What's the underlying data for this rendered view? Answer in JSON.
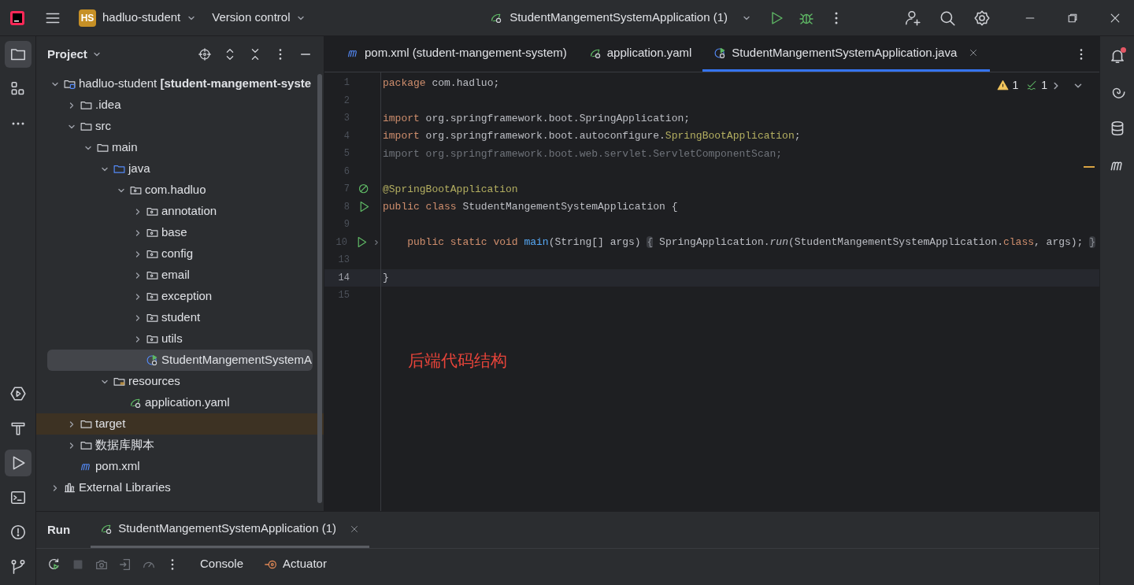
{
  "title_bar": {
    "project_badge": "HS",
    "project": "hadluo-student",
    "vcs": "Version control",
    "run_config": "StudentMangementSystemApplication (1)"
  },
  "left_toolbar": {
    "top": [
      {
        "kind": "folder",
        "selected": true
      },
      {
        "kind": "structure",
        "selected": false
      },
      {
        "kind": "more",
        "selected": false
      }
    ],
    "bottom": [
      {
        "kind": "services",
        "selected": false
      },
      {
        "kind": "build",
        "selected": false
      },
      {
        "kind": "run",
        "selected": true
      },
      {
        "kind": "terminal",
        "selected": false
      },
      {
        "kind": "problems",
        "selected": false
      },
      {
        "kind": "git",
        "selected": false
      }
    ]
  },
  "project_panel": {
    "title": "Project",
    "tree": [
      {
        "label": "hadluo-student **[student-mangement-syste**",
        "kind": "module",
        "expanded": true,
        "selected": false,
        "excluded": false,
        "children": [
          {
            "label": ".idea",
            "kind": "folder",
            "expanded": false,
            "selected": false,
            "excluded": false
          },
          {
            "label": "src",
            "kind": "folder",
            "expanded": true,
            "selected": false,
            "excluded": false,
            "children": [
              {
                "label": "main",
                "kind": "folder",
                "expanded": true,
                "selected": false,
                "excluded": false,
                "children": [
                  {
                    "label": "java",
                    "kind": "source",
                    "expanded": true,
                    "selected": false,
                    "excluded": false,
                    "children": [
                      {
                        "label": "com.hadluo",
                        "kind": "package",
                        "expanded": true,
                        "selected": false,
                        "excluded": false,
                        "children": [
                          {
                            "label": "annotation",
                            "kind": "package",
                            "expanded": false,
                            "selected": false,
                            "excluded": false
                          },
                          {
                            "label": "base",
                            "kind": "package",
                            "expanded": false,
                            "selected": false,
                            "excluded": false
                          },
                          {
                            "label": "config",
                            "kind": "package",
                            "expanded": false,
                            "selected": false,
                            "excluded": false
                          },
                          {
                            "label": "email",
                            "kind": "package",
                            "expanded": false,
                            "selected": false,
                            "excluded": false
                          },
                          {
                            "label": "exception",
                            "kind": "package",
                            "expanded": false,
                            "selected": false,
                            "excluded": false
                          },
                          {
                            "label": "student",
                            "kind": "package",
                            "expanded": false,
                            "selected": false,
                            "excluded": false
                          },
                          {
                            "label": "utils",
                            "kind": "package",
                            "expanded": false,
                            "selected": false,
                            "excluded": false
                          },
                          {
                            "label": "StudentMangementSystemA",
                            "kind": "spring-class",
                            "selected": true,
                            "excluded": false
                          }
                        ]
                      }
                    ]
                  },
                  {
                    "label": "resources",
                    "kind": "resources",
                    "expanded": true,
                    "selected": false,
                    "excluded": false,
                    "children": [
                      {
                        "label": "application.yaml",
                        "kind": "yaml",
                        "selected": false,
                        "excluded": false
                      }
                    ]
                  }
                ]
              }
            ]
          },
          {
            "label": "target",
            "kind": "folder",
            "expanded": false,
            "selected": false,
            "excluded": true
          },
          {
            "label": "数据库脚本",
            "kind": "folder",
            "expanded": false,
            "selected": false,
            "excluded": false
          },
          {
            "label": "pom.xml",
            "kind": "maven",
            "selected": false,
            "excluded": false
          }
        ]
      },
      {
        "label": "External Libraries",
        "kind": "libraries",
        "expanded": false,
        "selected": false,
        "excluded": false
      }
    ]
  },
  "editor_tabs": [
    {
      "label": "pom.xml (student-mangement-system)",
      "kind": "maven",
      "selected": false
    },
    {
      "label": "application.yaml",
      "kind": "yaml",
      "selected": false
    },
    {
      "label": "StudentMangementSystemApplication.java",
      "kind": "spring-class",
      "selected": true
    }
  ],
  "inspections": {
    "warnings": "1",
    "weak_warnings": "1"
  },
  "code": [
    {
      "n": "1",
      "current": false,
      "segments": [
        {
          "t": "package ",
          "kind": "kw"
        },
        {
          "t": "com.hadluo;",
          "kind": "plain"
        }
      ]
    },
    {
      "n": "2",
      "current": false
    },
    {
      "n": "3",
      "current": false,
      "segments": [
        {
          "t": "import ",
          "kind": "kw"
        },
        {
          "t": "org.springframework.boot.SpringApplication;",
          "kind": "plain"
        }
      ]
    },
    {
      "n": "4",
      "current": false,
      "segments": [
        {
          "t": "import ",
          "kind": "kw"
        },
        {
          "t": "org.springframework.boot.autoconfigure.",
          "kind": "plain"
        },
        {
          "t": "SpringBootApplication",
          "kind": "ann"
        },
        {
          "t": ";",
          "kind": "plain"
        }
      ]
    },
    {
      "n": "5",
      "current": false,
      "segments": [
        {
          "t": "import org.springframework.boot.web.servlet.ServletComponentScan;",
          "kind": "dim"
        }
      ]
    },
    {
      "n": "6",
      "current": false
    },
    {
      "n": "7",
      "current": false,
      "gutter": [
        {
          "kind": "bean"
        }
      ],
      "segments": [
        {
          "t": "@SpringBootApplication",
          "kind": "ann"
        }
      ]
    },
    {
      "n": "8",
      "current": false,
      "gutter": [
        {
          "kind": "run"
        }
      ],
      "segments": [
        {
          "t": "public class ",
          "kind": "kw"
        },
        {
          "t": "StudentMangementSystemApplication ",
          "kind": "plain"
        },
        {
          "t": "{",
          "kind": "plain"
        }
      ]
    },
    {
      "n": "9",
      "current": false
    },
    {
      "n": "10",
      "current": false,
      "gutter": [
        {
          "kind": "run"
        },
        {
          "kind": "fold"
        }
      ],
      "segments": [
        {
          "t": "    public static void ",
          "kind": "kw"
        },
        {
          "t": "main",
          "kind": "decl"
        },
        {
          "t": "(String[] args) ",
          "kind": "plain"
        },
        {
          "t": "{",
          "kind": "fold"
        },
        {
          "t": " SpringApplication.",
          "kind": "plain"
        },
        {
          "t": "run",
          "kind": "italic"
        },
        {
          "t": "(StudentMangementSystemApplication.",
          "kind": "plain"
        },
        {
          "t": "class",
          "kind": "kw"
        },
        {
          "t": ", args); ",
          "kind": "plain"
        },
        {
          "t": "}",
          "kind": "fold"
        }
      ]
    },
    {
      "n": "13",
      "current": false
    },
    {
      "n": "14",
      "current": true,
      "segments": [
        {
          "t": "}",
          "kind": "plain"
        }
      ]
    },
    {
      "n": "15",
      "current": false
    }
  ],
  "annotation_text": "后端代码结构",
  "right_toolbar": [
    {
      "kind": "notifications"
    },
    {
      "kind": "ai"
    },
    {
      "kind": "database"
    },
    {
      "kind": "maven"
    }
  ],
  "run_panel": {
    "title": "Run",
    "tab": "StudentMangementSystemApplication (1)",
    "toolbar": [
      {
        "kind": "rerun",
        "disabled": false
      },
      {
        "kind": "stop",
        "disabled": true
      },
      {
        "kind": "camera",
        "disabled": true
      },
      {
        "kind": "import",
        "disabled": true
      },
      {
        "kind": "gauge",
        "disabled": true
      },
      {
        "kind": "more",
        "disabled": false
      }
    ],
    "views": [
      {
        "label": "Console",
        "kind": "console"
      },
      {
        "label": "Actuator",
        "kind": "actuator"
      }
    ]
  }
}
